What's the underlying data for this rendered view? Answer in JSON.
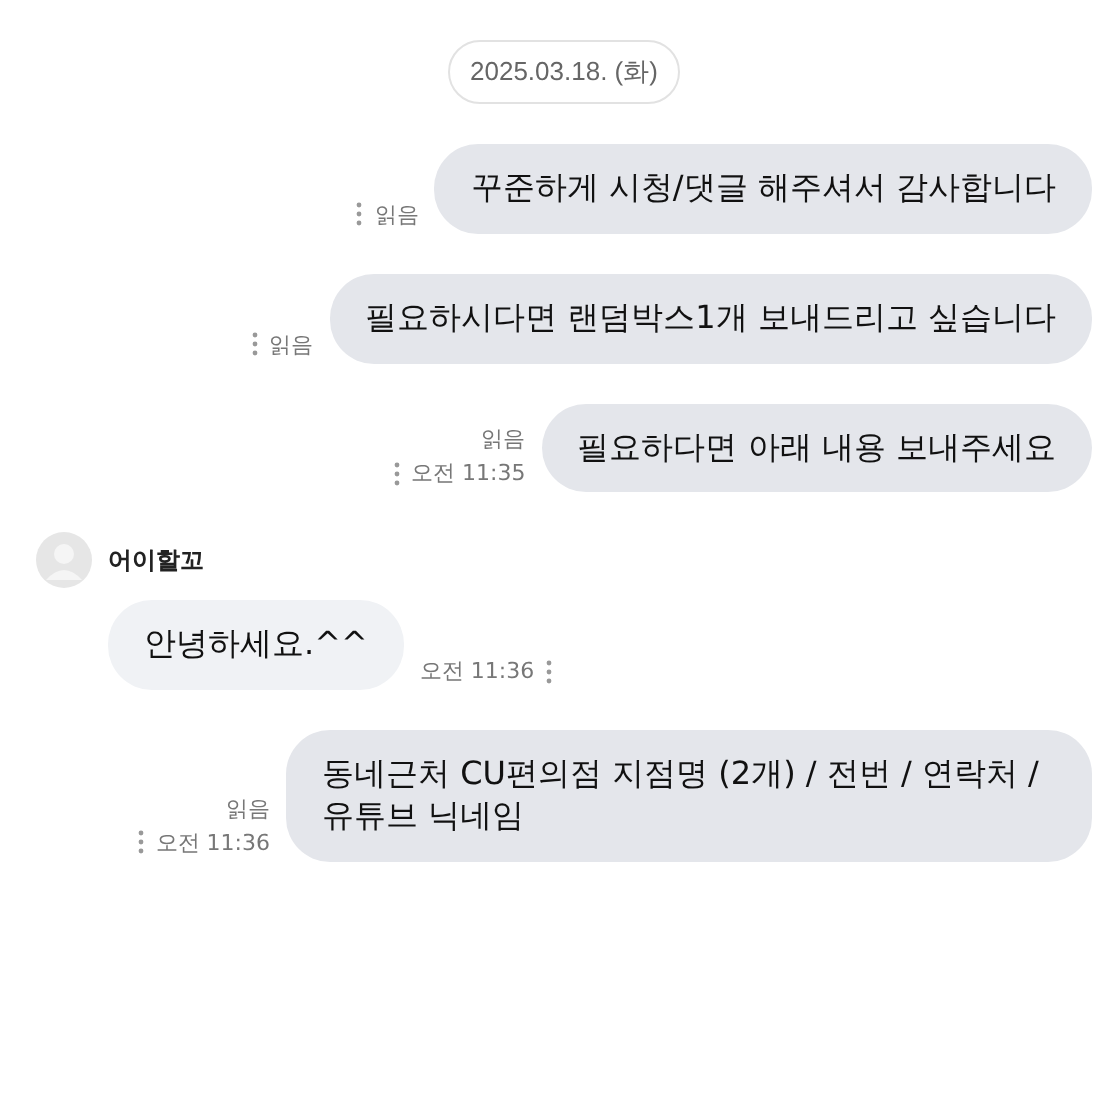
{
  "date_divider": "2025.03.18. (화)",
  "messages": [
    {
      "kind": "sent",
      "text": "꾸준하게 시청/댓글 해주셔서 감사합니다",
      "read": "읽음"
    },
    {
      "kind": "sent",
      "text": "필요하시다면 랜덤박스1개 보내드리고 싶습니다",
      "read": "읽음"
    },
    {
      "kind": "sent",
      "text": "필요하다면 아래 내용 보내주세요",
      "read": "읽음",
      "time": "오전 11:35"
    },
    {
      "kind": "received",
      "sender": "어이할꼬",
      "text": "안녕하세요.^^",
      "time": "오전 11:36"
    },
    {
      "kind": "sent",
      "text": "동네근처 CU편의점 지점명 (2개) / 전번 / 연락처 / 유튜브 닉네임",
      "read": "읽음",
      "time": "오전 11:36"
    }
  ]
}
